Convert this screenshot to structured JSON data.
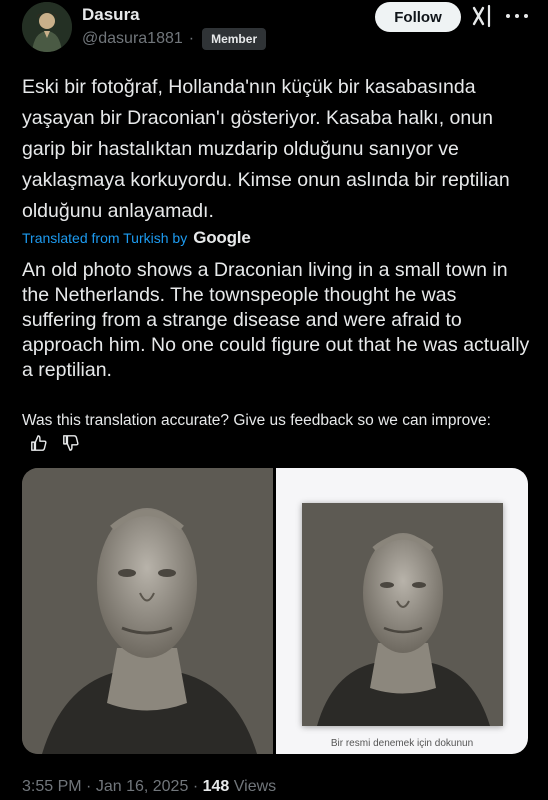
{
  "tweet": {
    "author_name": "Dasura",
    "handle": "@dasura1881",
    "separator": "·",
    "badge": "Member",
    "follow_label": "Follow",
    "original_text": "Eski bir fotoğraf, Hollanda'nın küçük bir kasabasında yaşayan bir Draconian'ı gösteriyor. Kasaba halkı, onun garip bir hastalıktan muzdarip olduğunu sanıyor ve yaklaşmaya korkuyordu. Kimse onun aslında bir reptilian olduğunu anlayamadı.",
    "translated_label": "Translated from Turkish by",
    "translator": "Google",
    "translation": "An old photo shows a Draconian living in a small town in the Netherlands. The townspeople thought he was suffering from a strange disease and were afraid to approach him. No one could figure out that he was actually a reptilian.",
    "feedback_text": "Was this translation accurate? Give us feedback so we can improve:",
    "media_caption": "Bir resmi denemek için dokunun",
    "time": "3:55 PM",
    "date": "Jan 16, 2025",
    "views_count": "148",
    "views_label": "Views"
  },
  "icons": {
    "grok": "grok-icon",
    "more": "more-icon",
    "thumbs_up": "thumbs-up-icon",
    "thumbs_down": "thumbs-down-icon"
  },
  "colors": {
    "background": "#000000",
    "text": "#e7e9ea",
    "muted": "#71767b",
    "link": "#1d9bf0",
    "button_bg": "#eff3f4"
  }
}
